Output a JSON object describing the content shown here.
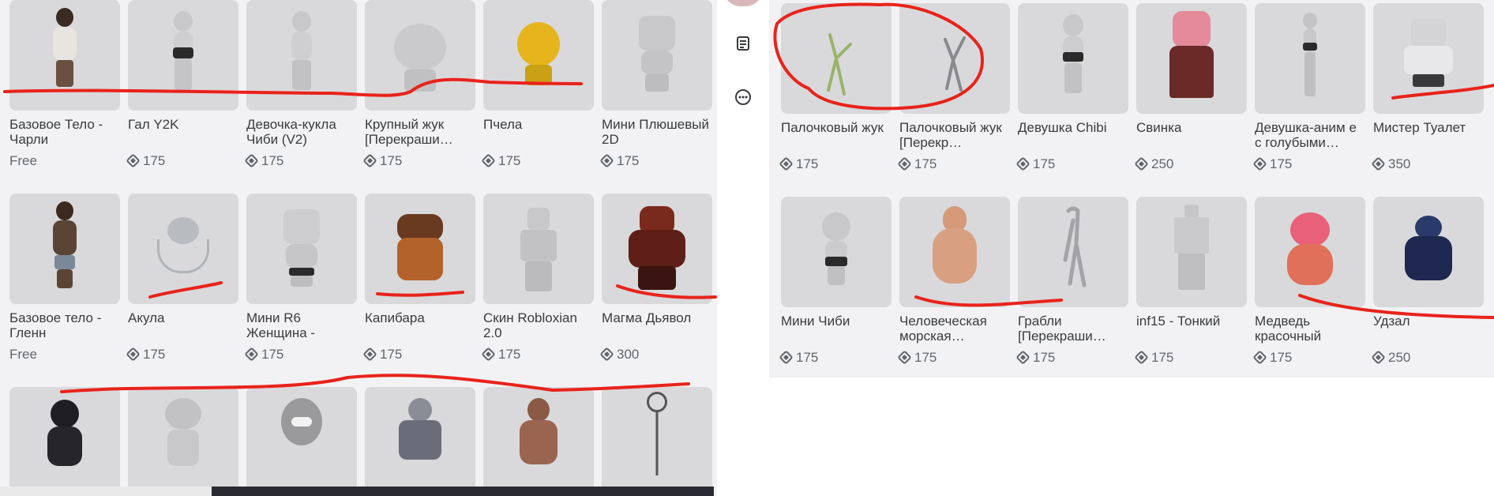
{
  "colors": {
    "panel_bg": "#f2f2f4",
    "thumb_bg": "#d9d9db",
    "annotation": "#e8231b",
    "text": "#393b3d",
    "muted": "#60656a"
  },
  "left_grid": [
    {
      "name": "Базовое Тело - Чарли",
      "price": "Free",
      "is_free": true
    },
    {
      "name": "Гал Y2K",
      "price": "175"
    },
    {
      "name": "Девочка-кукла Чиби (V2)",
      "price": "175"
    },
    {
      "name": "Крупный жук [Перекраши…",
      "price": "175"
    },
    {
      "name": "Пчела",
      "price": "175"
    },
    {
      "name": "Мини Плюшевый 2D",
      "price": "175"
    },
    {
      "name": "Базовое тело - Гленн",
      "price": "Free",
      "is_free": true
    },
    {
      "name": "Акула",
      "price": "175"
    },
    {
      "name": "Мини R6 Женщина -",
      "price": "175"
    },
    {
      "name": "Капибара",
      "price": "175"
    },
    {
      "name": "Скин Robloxian 2.0",
      "price": "175"
    },
    {
      "name": "Магма Дьявол",
      "price": "300"
    }
  ],
  "right_grid": [
    {
      "name": "Палочковый жук",
      "price": "175"
    },
    {
      "name": "Палочковый жук [Перекр…",
      "price": "175"
    },
    {
      "name": "Девушка Chibi",
      "price": "175"
    },
    {
      "name": "Свинка",
      "price": "250"
    },
    {
      "name": "Девушка-аним е с голубыми…",
      "price": "175"
    },
    {
      "name": "Мистер Туалет",
      "price": "350"
    },
    {
      "name": "Мини Чиби",
      "price": "175"
    },
    {
      "name": "Человеческая морская…",
      "price": "175"
    },
    {
      "name": "Грабли [Перекраши…",
      "price": "175"
    },
    {
      "name": "inf15 - Тонкий",
      "price": "175"
    },
    {
      "name": "Медведь красочный",
      "price": "175"
    },
    {
      "name": "Удзал",
      "price": "250"
    }
  ],
  "side_rail": {
    "icons": [
      "avatar-icon",
      "notes-icon",
      "more-icon"
    ]
  }
}
